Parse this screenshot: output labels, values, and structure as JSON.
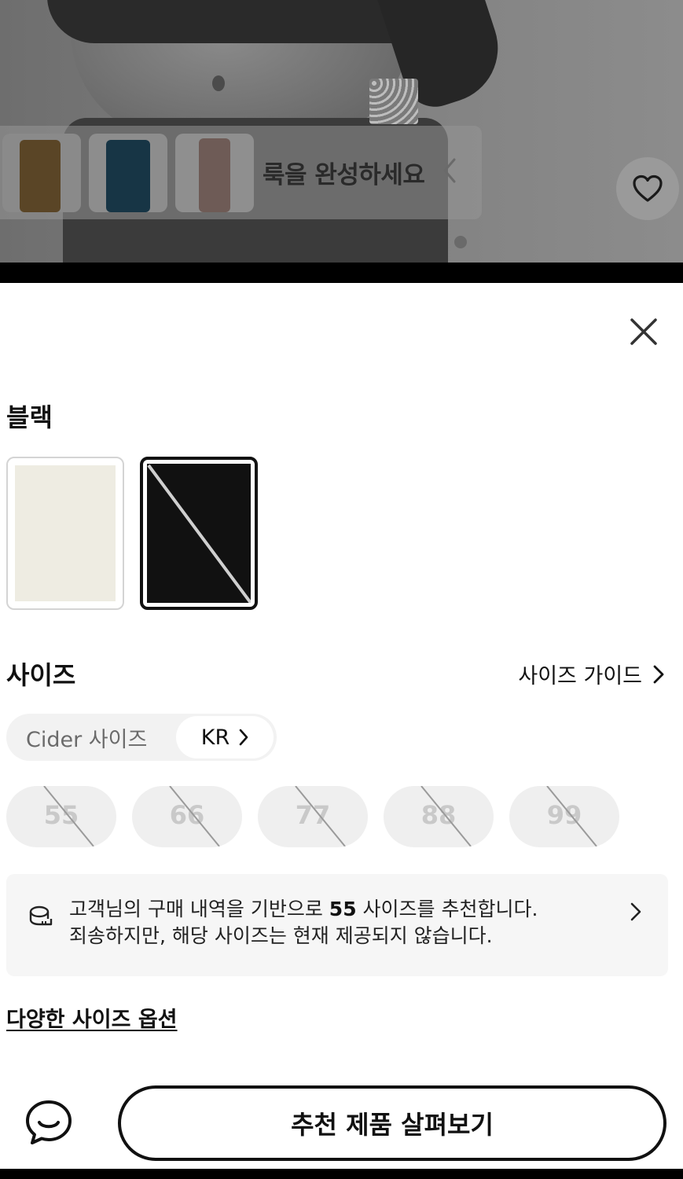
{
  "hero": {
    "look_strip": {
      "title": "룩을 완성하세요",
      "thumbnails": [
        "brown-wide-pants",
        "blue-wide-jeans",
        "brown-midi-skirt"
      ]
    }
  },
  "sheet": {
    "selected_color": "블랙",
    "color_options": [
      {
        "name": "ivory",
        "hex": "#eeece2",
        "available": true
      },
      {
        "name": "black",
        "hex": "#111111",
        "available": false,
        "selected": true
      }
    ],
    "size_section": {
      "title": "사이즈",
      "guide_label": "사이즈 가이드",
      "system_label": "Cider 사이즈",
      "system_value": "KR",
      "sizes": [
        {
          "label": "55",
          "available": false
        },
        {
          "label": "66",
          "available": false
        },
        {
          "label": "77",
          "available": false
        },
        {
          "label": "88",
          "available": false
        },
        {
          "label": "99",
          "available": false
        }
      ]
    },
    "recommendation": {
      "line1_prefix": "고객님의 구매 내역을 기반으로 ",
      "line1_size": "55",
      "line1_suffix": " 사이즈를 추천합니다.",
      "line2": "죄송하지만, 해당 사이즈는 현재 제공되지 않습니다."
    },
    "options_link": "다양한 사이즈 옵션",
    "cta_label": "추천 제품 살펴보기"
  },
  "colors": {
    "accent": "#111111",
    "disabled_chip_bg": "#efefef",
    "disabled_chip_text": "#c9c9c9"
  }
}
